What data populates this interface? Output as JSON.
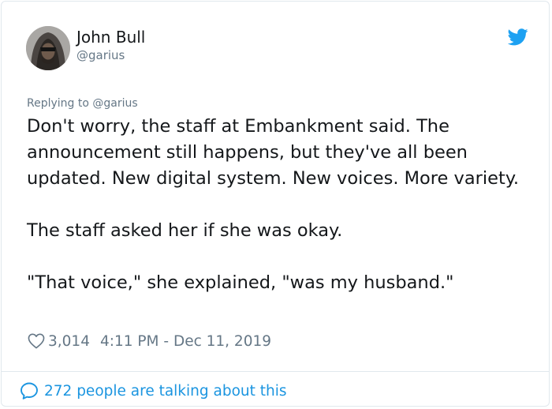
{
  "author": {
    "name": "John Bull",
    "handle": "@garius"
  },
  "reply": {
    "text": "Replying to @garius"
  },
  "tweet": {
    "paragraphs": [
      "Don't worry, the staff at Embankment said. The announcement still happens, but they've all been updated. New digital system. New voices. More variety.",
      "The staff asked her if she was okay.",
      "\"That voice,\" she explained, \"was my husband.\""
    ]
  },
  "meta": {
    "likes": "3,014",
    "timestamp": "4:11 PM - Dec 11, 2019"
  },
  "footer": {
    "talking": "272 people are talking about this"
  },
  "icons": {
    "brand": "twitter-bird-icon",
    "like": "heart-icon",
    "reply": "speech-bubble-icon"
  },
  "colors": {
    "brand_blue": "#1da1f2",
    "link_blue": "#1b95e0",
    "secondary_text": "#657786",
    "primary_text": "#14171a",
    "border": "#e1e8ed"
  }
}
